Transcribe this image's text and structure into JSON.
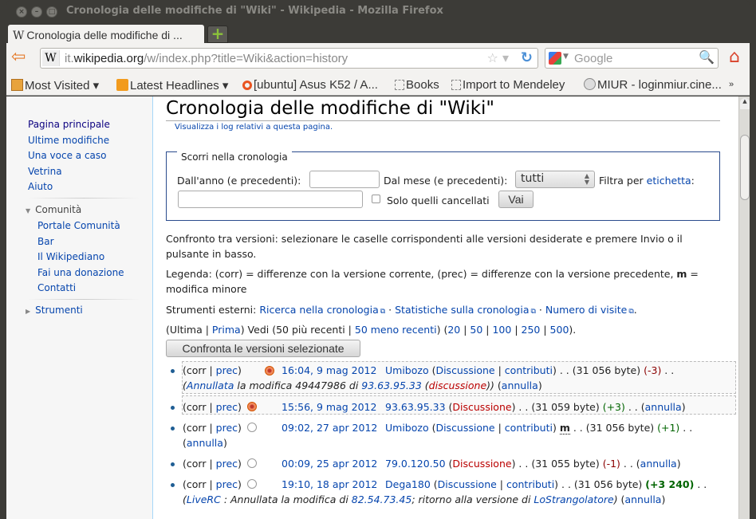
{
  "window": {
    "title": "Cronologia delle modifiche di \"Wiki\" - Wikipedia - Mozilla Firefox",
    "controls": [
      "close",
      "minimize",
      "maximize"
    ]
  },
  "tabs": [
    {
      "favicon": "W",
      "label": "Cronologia delle modifiche di ..."
    }
  ],
  "navbar": {
    "url_domain_prefix": "it.",
    "url_domain": "wikipedia.org",
    "url_path": "/w/index.php?title=Wiki&action=history",
    "search_placeholder": "Google"
  },
  "bookmarks": [
    {
      "icon": "folder-icon",
      "label": "Most Visited ▾"
    },
    {
      "icon": "rss-icon",
      "label": "Latest Headlines ▾"
    },
    {
      "icon": "ubuntu-icon",
      "label": "[ubuntu] Asus K52 / A..."
    },
    {
      "icon": "page-icon",
      "label": "Books"
    },
    {
      "icon": "page-icon",
      "label": "Import to Mendeley"
    },
    {
      "icon": "miur-icon",
      "label": "MIUR - loginmiur.cine..."
    },
    {
      "icon": "overflow-icon",
      "label": "»"
    }
  ],
  "sidebar": {
    "main_links": [
      "Pagina principale",
      "Ultime modifiche",
      "Una voce a caso",
      "Vetrina",
      "Aiuto"
    ],
    "community_heading": "Comunità",
    "community_links": [
      "Portale Comunità",
      "Bar",
      "Il Wikipediano",
      "Fai una donazione",
      "Contatti"
    ],
    "tools_heading": "Strumenti"
  },
  "page": {
    "title": "Cronologia delle modifiche di \"Wiki\"",
    "log_link": "Visualizza i log relativi a questa pagina.",
    "nav_form": {
      "legend": "Scorri nella cronologia",
      "year_label": "Dall'anno (e precedenti):",
      "year_value": "",
      "month_label": "Dal mese (e precedenti):",
      "month_value": "tutti",
      "tag_label_prefix": "Filtra per ",
      "tag_label_link": "etichetta",
      "tag_label_suffix": ":",
      "tag_value": "",
      "deleted_label": "Solo quelli cancellati",
      "deleted_checked": false,
      "go_button": "Vai"
    },
    "compare_help": "Confronto tra versioni: selezionare le caselle corrispondenti alle versioni desiderate e premere Invio o il pulsante in basso.",
    "legend_text_a": "Legenda: (corr) = differenze con la versione corrente, (prec) = differenze con la versione precedente, ",
    "legend_m": "m",
    "legend_text_b": " = modifica minore",
    "external_tools_label": "Strumenti esterni: ",
    "external_tools": [
      "Ricerca nella cronologia",
      "Statistiche sulla cronologia",
      "Numero di visite"
    ],
    "paging": {
      "ultima": "Ultima",
      "prima": "Prima",
      "vedi": "Vedi",
      "newer": "50 più recenti",
      "older": "50 meno recenti",
      "limits": [
        "20",
        "50",
        "100",
        "250",
        "500"
      ]
    },
    "compare_button": "Confronta le versioni selezionate",
    "revisions": [
      {
        "corr": "corr",
        "prec": "prec",
        "radio": "on",
        "date": "16:04, 9 mag 2012",
        "user": "Umibozo",
        "talk": "Discussione",
        "talk_red": false,
        "contribs": "contributi",
        "minor": false,
        "size": "(31 056 byte)",
        "diff": "(-3)",
        "diff_type": "neg",
        "summary_prefix": "(",
        "summary_link1": "Annullata",
        "summary_mid": " la modifica 49447986 di ",
        "summary_link2": "93.63.95.33",
        "summary_link3": "discussione",
        "undo": "annulla"
      },
      {
        "corr": "corr",
        "prec": "prec",
        "radio": "on",
        "date": "15:56, 9 mag 2012",
        "user": "93.63.95.33",
        "talk": "Discussione",
        "talk_red": true,
        "size": "(31 059 byte)",
        "diff": "(+3)",
        "diff_type": "pos",
        "undo": "annulla"
      },
      {
        "corr": "corr",
        "prec": "prec",
        "radio": "off",
        "date": "09:02, 27 apr 2012",
        "user": "Umibozo",
        "talk": "Discussione",
        "talk_red": false,
        "contribs": "contributi",
        "minor": true,
        "minor_label": "m",
        "size": "(31 056 byte)",
        "diff": "(+1)",
        "diff_type": "pos",
        "undo": "annulla"
      },
      {
        "corr": "corr",
        "prec": "prec",
        "radio": "off",
        "date": "00:09, 25 apr 2012",
        "user": "79.0.120.50",
        "talk": "Discussione",
        "talk_red": true,
        "size": "(31 055 byte)",
        "diff": "(-1)",
        "diff_type": "neg",
        "undo": "annulla"
      },
      {
        "corr": "corr",
        "prec": "prec",
        "radio": "off",
        "date": "19:10, 18 apr 2012",
        "user": "Dega180",
        "talk": "Discussione",
        "talk_red": false,
        "contribs": "contributi",
        "size": "(31 056 byte)",
        "diff": "(+3 240)",
        "diff_type": "pos-big",
        "summary_link1": "LiveRC",
        "summary_mid": " : Annullata la modifica di ",
        "summary_link2": "82.54.73.45",
        "summary_mid2": "; ritorno alla versione di ",
        "summary_link3": "LoStrangolatore",
        "undo": "annulla"
      }
    ]
  },
  "colors": {
    "link": "#0645ad",
    "redlink": "#ba0000",
    "positive": "#006400",
    "negative": "#8b0000",
    "window_chrome": "#3c3b37"
  }
}
